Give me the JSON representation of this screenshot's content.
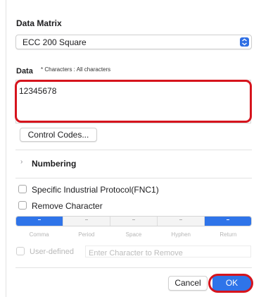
{
  "dialog": {
    "section_title": "Data Matrix",
    "symbol_select": {
      "value": "ECC 200  Square"
    },
    "data_label": "Data",
    "data_hint": "* Characters : All characters",
    "data_value": "12345678",
    "control_codes_label": "Control Codes...",
    "numbering_label": "Numbering",
    "fnc1_label": "Specific Industrial Protocol(FNC1)",
    "fnc1_checked": false,
    "remove_char_label": "Remove Character",
    "remove_char_checked": false,
    "separators": [
      {
        "label": "Comma",
        "selected": true
      },
      {
        "label": "Period",
        "selected": false
      },
      {
        "label": "Space",
        "selected": false
      },
      {
        "label": "Hyphen",
        "selected": false
      },
      {
        "label": "Return",
        "selected": true
      }
    ],
    "user_defined_label": "User-defined",
    "user_defined_placeholder": "Enter Character to Remove",
    "cancel_label": "Cancel",
    "ok_label": "OK"
  },
  "colors": {
    "accent": "#2f74e9",
    "highlight": "#d6141d"
  }
}
